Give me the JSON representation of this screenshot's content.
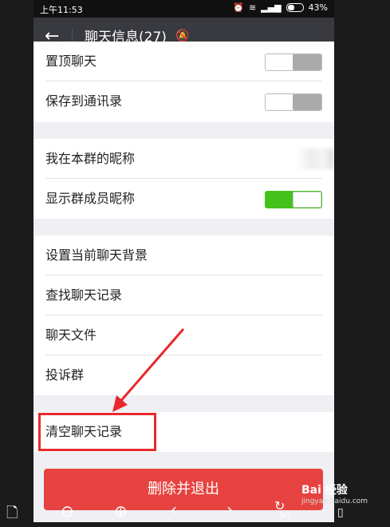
{
  "status": {
    "time": "上午11:53",
    "battery": "43%"
  },
  "header": {
    "back": "←",
    "title": "聊天信息(27)",
    "mute": "🔕"
  },
  "groups": {
    "g1": [
      "置顶聊天",
      "保存到通讯录"
    ],
    "g2": [
      "我在本群的昵称",
      "显示群成员昵称"
    ],
    "g3": [
      "设置当前聊天背景",
      "查找聊天记录",
      "聊天文件",
      "投诉群"
    ],
    "g4": [
      "清空聊天记录"
    ]
  },
  "toggles": {
    "pin": "off",
    "save_contacts": "off",
    "show_nicknames": "on"
  },
  "delete_button": "删除并退出",
  "colors": {
    "danger": "#e64340",
    "toggle_on": "#44c21b",
    "highlight": "#e8292c"
  },
  "viewer_toolbar": {
    "icons": [
      "document-icon",
      "zoom-out-icon",
      "zoom-in-icon",
      "prev-icon",
      "next-icon",
      "rotate-icon",
      "trash-icon"
    ],
    "rotate_value": "90"
  },
  "watermark": {
    "brand": "Bai 经验",
    "site": "jingyan.baidu.com"
  }
}
